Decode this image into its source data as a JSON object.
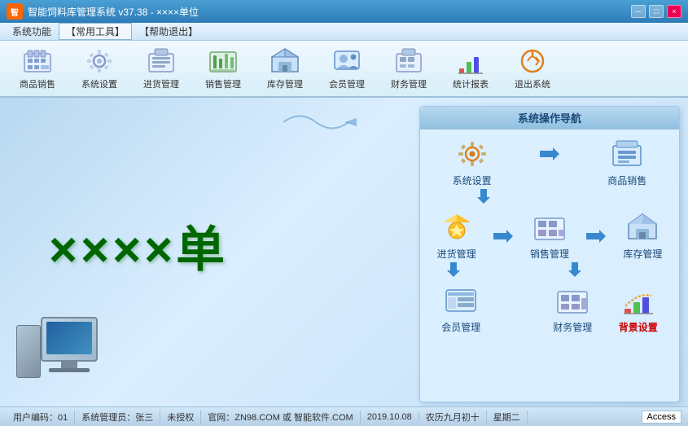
{
  "window": {
    "title": "智能饲料库管理系统 v37.38 - ××××单位",
    "logo_text": "智"
  },
  "title_controls": {
    "minimize": "─",
    "maximize": "□",
    "close": "×"
  },
  "menu": {
    "items": [
      "系统功能",
      "常用工具",
      "帮助退出"
    ]
  },
  "toolbar": {
    "buttons": [
      {
        "id": "goods-sale",
        "label": "商品销售",
        "icon": "🛒"
      },
      {
        "id": "sys-setting",
        "label": "系统设置",
        "icon": "⚙"
      },
      {
        "id": "stock-in",
        "label": "进货管理",
        "icon": "🧮"
      },
      {
        "id": "sale-mgmt",
        "label": "销售管理",
        "icon": "💹"
      },
      {
        "id": "inventory",
        "label": "库存管理",
        "icon": "🏠"
      },
      {
        "id": "member",
        "label": "会员管理",
        "icon": "👥"
      },
      {
        "id": "finance",
        "label": "财务管理",
        "icon": "💰"
      },
      {
        "id": "report",
        "label": "统计报表",
        "icon": "📊"
      },
      {
        "id": "exit",
        "label": "退出系统",
        "icon": "🔄"
      }
    ]
  },
  "main": {
    "big_text": "××××单",
    "nav_panel_title": "系统操作导航",
    "nav_items": [
      {
        "id": "sys-setting",
        "label": "系统设置",
        "icon": "🔧"
      },
      {
        "id": "goods-sale",
        "label": "商品销售",
        "icon": "🖥"
      },
      {
        "id": "stock-in",
        "label": "进货管理",
        "icon": "⭐"
      },
      {
        "id": "sale-mgmt",
        "label": "销售管理",
        "icon": "🧮"
      },
      {
        "id": "inventory",
        "label": "库存管理",
        "icon": "🏠"
      },
      {
        "id": "member",
        "label": "会员管理",
        "icon": "🖥"
      },
      {
        "id": "finance",
        "label": "财务管理",
        "icon": "💰"
      },
      {
        "id": "bg-settings",
        "label": "背景设置",
        "icon": "📊"
      }
    ]
  },
  "status": {
    "user_code": "用户编码：01",
    "user_name": "系统管理员：张三",
    "auth": "未授权",
    "official": "官网：ZN98.COM 或 智能软件.COM",
    "date": "2019.10.08",
    "lunar": "农历九月初十",
    "weekday": "星期二",
    "access": "Access"
  }
}
